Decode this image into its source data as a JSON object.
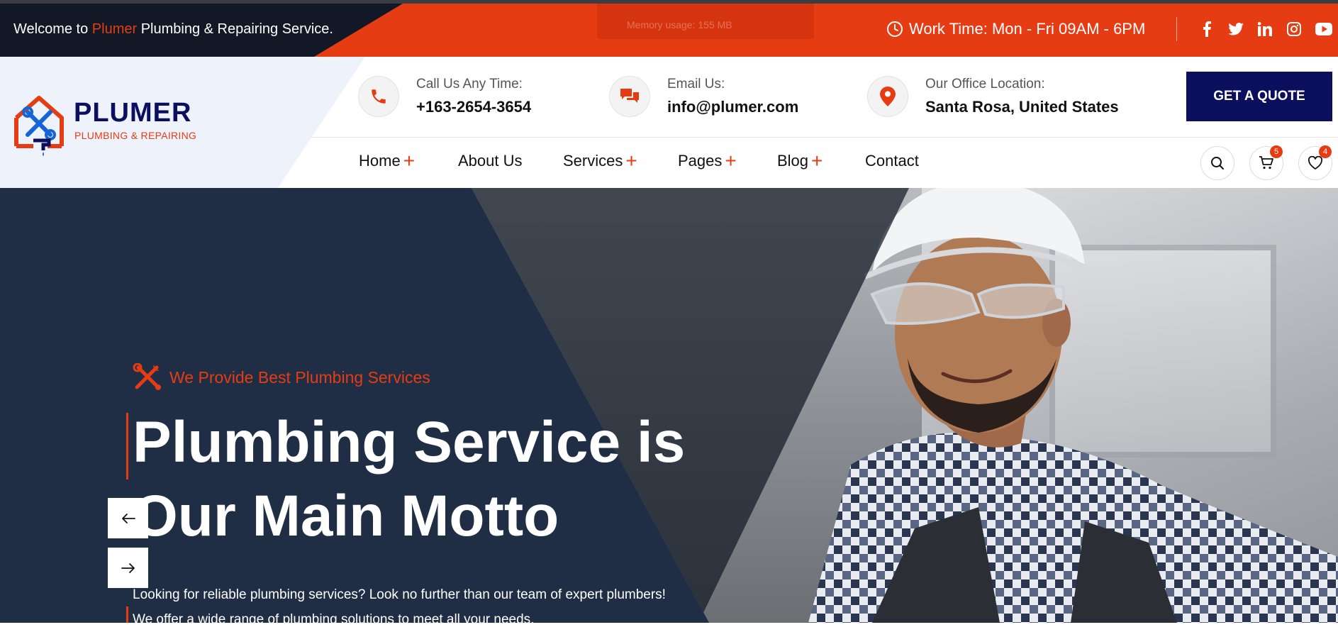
{
  "topbar": {
    "welcome_prefix": "Welcome to",
    "welcome_brand": "Plumer",
    "welcome_suffix": "Plumbing & Repairing Service.",
    "memory_usage": "Memory usage: 155 MB",
    "work_time": "Work Time: Mon - Fri 09AM - 6PM",
    "social": [
      "facebook-icon",
      "twitter-icon",
      "linkedin-icon",
      "instagram-icon",
      "youtube-icon"
    ]
  },
  "logo": {
    "name": "PLUMER",
    "tagline": "PLUMBING & REPAIRING"
  },
  "contact": {
    "call_label": "Call Us Any Time:",
    "call_value": "+163-2654-3654",
    "email_label": "Email Us:",
    "email_value": "info@plumer.com",
    "office_label": "Our Office Location:",
    "office_value": "Santa Rosa, United States"
  },
  "quote_button": "GET A QUOTE",
  "nav": {
    "items": [
      {
        "label": "Home",
        "has_submenu": true
      },
      {
        "label": "About Us",
        "has_submenu": false
      },
      {
        "label": "Services",
        "has_submenu": true
      },
      {
        "label": "Pages",
        "has_submenu": true
      },
      {
        "label": "Blog",
        "has_submenu": true
      },
      {
        "label": "Contact",
        "has_submenu": false
      }
    ],
    "plus": "+"
  },
  "actions": {
    "cart_count": "5",
    "wishlist_count": "4"
  },
  "hero": {
    "kicker": "We Provide Best Plumbing Services",
    "title_line1": "Plumbing Service is",
    "title_line2": "Our Main Motto",
    "description_line1": "Looking for reliable plumbing services? Look no further than our team of expert plumbers!",
    "description_line2": "We offer a wide range of plumbing solutions to meet all your needs."
  },
  "colors": {
    "accent": "#e63c14",
    "navy": "#0c0e5e",
    "dark": "#121826",
    "hero_navy": "#1f2e44"
  }
}
